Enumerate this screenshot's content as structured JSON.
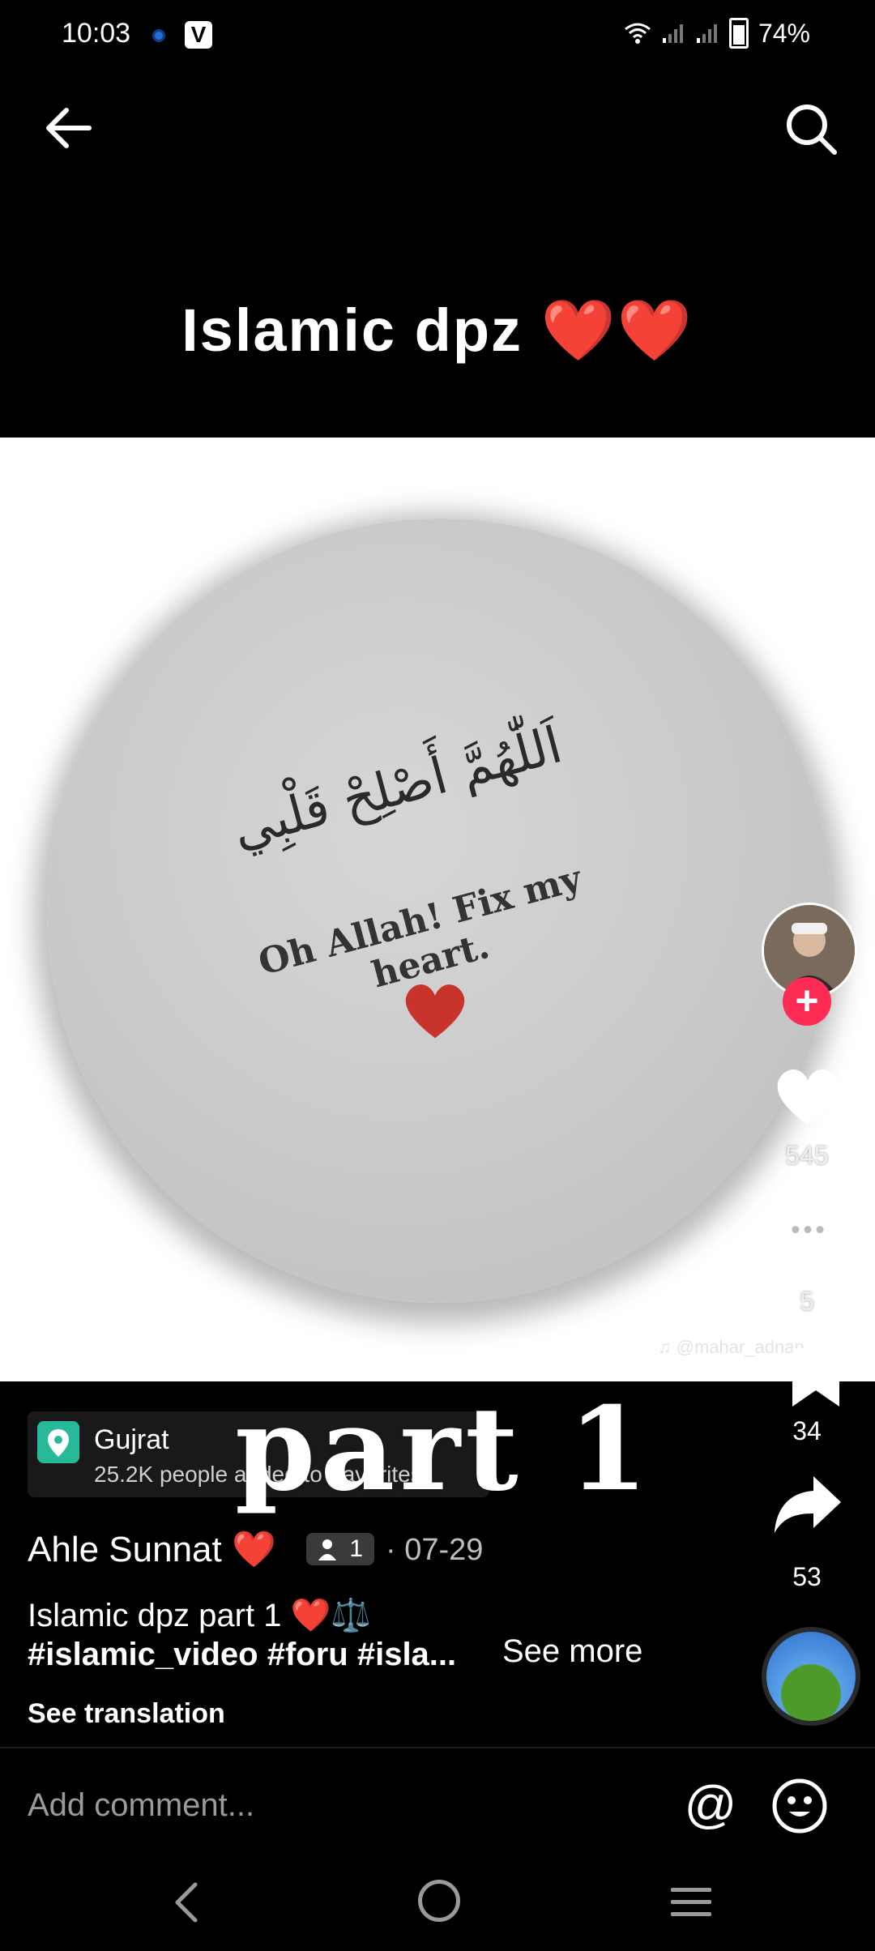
{
  "status_bar": {
    "time": "10:03",
    "battery": "74%",
    "app_badge": "V"
  },
  "nav": {
    "back_icon": "arrow-left-icon",
    "search_icon": "search-icon"
  },
  "video": {
    "title": "Islamic dpz ❤️❤️",
    "arabic_text": "اَللّٰهُمَّ أَصْلِحْ قَلْبِي",
    "quote": "Oh Allah! Fix my heart.",
    "watermark": "♫ @mahar_adnan_",
    "overlay_text": "part 1"
  },
  "location": {
    "name": "Gujrat",
    "subtitle": "25.2K people added to Favorites"
  },
  "rail": {
    "like_count": "545",
    "comment_count": "5",
    "bookmark_count": "34",
    "share_count": "53"
  },
  "post": {
    "author": "Ahle Sunnat ❤️",
    "collab_count": "1",
    "date": "· 07-29",
    "caption": "Islamic dpz part 1 ❤️⚖️",
    "hashtags": "#islamic_video #foru #isla...",
    "see_more": "See more",
    "see_translation": "See translation"
  },
  "comment_bar": {
    "placeholder": "Add comment...",
    "mention": "@"
  },
  "colors": {
    "accent": "#fe2c55",
    "location_icon": "#27b99a"
  }
}
